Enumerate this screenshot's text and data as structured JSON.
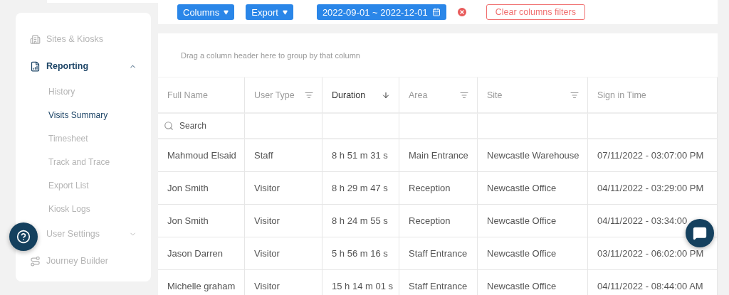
{
  "sidebar": {
    "items": [
      {
        "label": "Sites & Kiosks",
        "selected": false
      },
      {
        "label": "Reporting",
        "selected": true,
        "expanded": true,
        "children": [
          {
            "label": "History",
            "selected": false
          },
          {
            "label": "Visits Summary",
            "selected": true
          },
          {
            "label": "Timesheet",
            "selected": false
          },
          {
            "label": "Track and Trace",
            "selected": false
          },
          {
            "label": "Export List",
            "selected": false
          },
          {
            "label": "Kiosk Logs",
            "selected": false
          }
        ]
      },
      {
        "label": "User Settings",
        "selected": false,
        "expanded": false
      },
      {
        "label": "Journey Builder",
        "selected": false
      }
    ]
  },
  "toolbar": {
    "columns_button": "Columns",
    "export_button": "Export",
    "date_range": "2022-09-01 ~ 2022-12-01",
    "clear_filters_button": "Clear columns filters"
  },
  "group_panel": {
    "hint": "Drag a column header here to group by that column"
  },
  "table": {
    "columns": [
      {
        "label": "Full Name",
        "filterable": false,
        "sorted": false
      },
      {
        "label": "User Type",
        "filterable": true,
        "sorted": false
      },
      {
        "label": "Duration",
        "filterable": false,
        "sorted": true
      },
      {
        "label": "Area",
        "filterable": true,
        "sorted": false
      },
      {
        "label": "Site",
        "filterable": true,
        "sorted": false
      },
      {
        "label": "Sign in Time",
        "filterable": false,
        "sorted": false
      }
    ],
    "search": {
      "placeholder": "Search"
    },
    "rows": [
      [
        "Mahmoud Elsaid",
        "Staff",
        "8 h 51 m 31 s",
        "Main Entrance",
        "Newcastle Warehouse",
        "07/11/2022 - 03:07:00 PM"
      ],
      [
        "Jon Smith",
        "Visitor",
        "8 h 29 m 47 s",
        "Reception",
        "Newcastle Office",
        "04/11/2022 - 03:29:00 PM"
      ],
      [
        "Jon Smith",
        "Visitor",
        "8 h 24 m 55 s",
        "Reception",
        "Newcastle Office",
        "04/11/2022 - 03:34:00"
      ],
      [
        "Jason Darren",
        "Visitor",
        "5 h 56 m 16 s",
        "Staff Entrance",
        "Newcastle Office",
        "03/11/2022 - 06:02:00 PM"
      ],
      [
        "Michelle graham",
        "Visitor",
        "15 h 14 m 01 s",
        "Staff Entrance",
        "Newcastle Office",
        "04/11/2022 - 08:44:00 AM"
      ]
    ]
  }
}
